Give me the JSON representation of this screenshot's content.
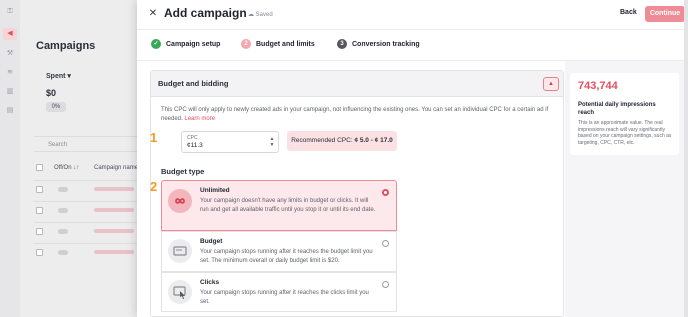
{
  "colors": {
    "accent": "#e04f5f",
    "continue_bg": "#ef8c97",
    "selected_bg": "#fde8eb",
    "recommended_bg": "#fbe1e4",
    "step_done": "#3aa957",
    "step_active": "#f5a5ae",
    "marker": "#f59b25"
  },
  "background": {
    "title": "Campaigns",
    "spent_label": "Spent ▾",
    "spent_value": "$0",
    "spent_percent": "0%",
    "search_placeholder": "Search",
    "col_onoff": "Off/On ↓↑",
    "col_name": "Campaign name",
    "rows": 5
  },
  "header": {
    "title": "Add campaign",
    "saved": "Saved",
    "back_label": "Back",
    "continue_label": "Continue"
  },
  "steps": [
    {
      "num": "✓",
      "label": "Campaign setup",
      "state": "done"
    },
    {
      "num": "2",
      "label": "Budget and limits",
      "state": "active"
    },
    {
      "num": "3",
      "label": "Conversion tracking",
      "state": "pending"
    }
  ],
  "section": {
    "title": "Budget and bidding",
    "note_text": "This CPC will only apply to newly created ads in your campaign, not influencing the existing ones. You can set an individual CPC for a certain ad if needed.",
    "note_link": "Learn more",
    "marker1": "1",
    "marker2": "2",
    "cpc_label": "CPC",
    "cpc_value": "¢11.3",
    "recommended_prefix": "Recommended CPC:",
    "recommended_range": "¢ 5.0 - ¢ 17.0",
    "budget_type_title": "Budget type",
    "options": [
      {
        "title": "Unlimited",
        "desc": "Your campaign doesn't have any limits in budget or clicks. It will run and get all available traffic until you stop it or until its end date.",
        "icon": "infinity-icon",
        "selected": true
      },
      {
        "title": "Budget",
        "desc": "Your campaign stops running after it reaches the budget limit you set. The minimum overall or daily budget limit is $20.",
        "icon": "wallet-icon",
        "selected": false
      },
      {
        "title": "Clicks",
        "desc": "Your campaign stops running after it reaches the clicks limit you set.",
        "icon": "cursor-click-icon",
        "selected": false
      }
    ]
  },
  "sidebar": {
    "reach_value": "743,744",
    "reach_title": "Potential daily impressions reach",
    "reach_note": "This is an approximate value. The real impressions reach will vary significantly based on your campaign settings, such as targeting, CPC, CTR, etc."
  }
}
